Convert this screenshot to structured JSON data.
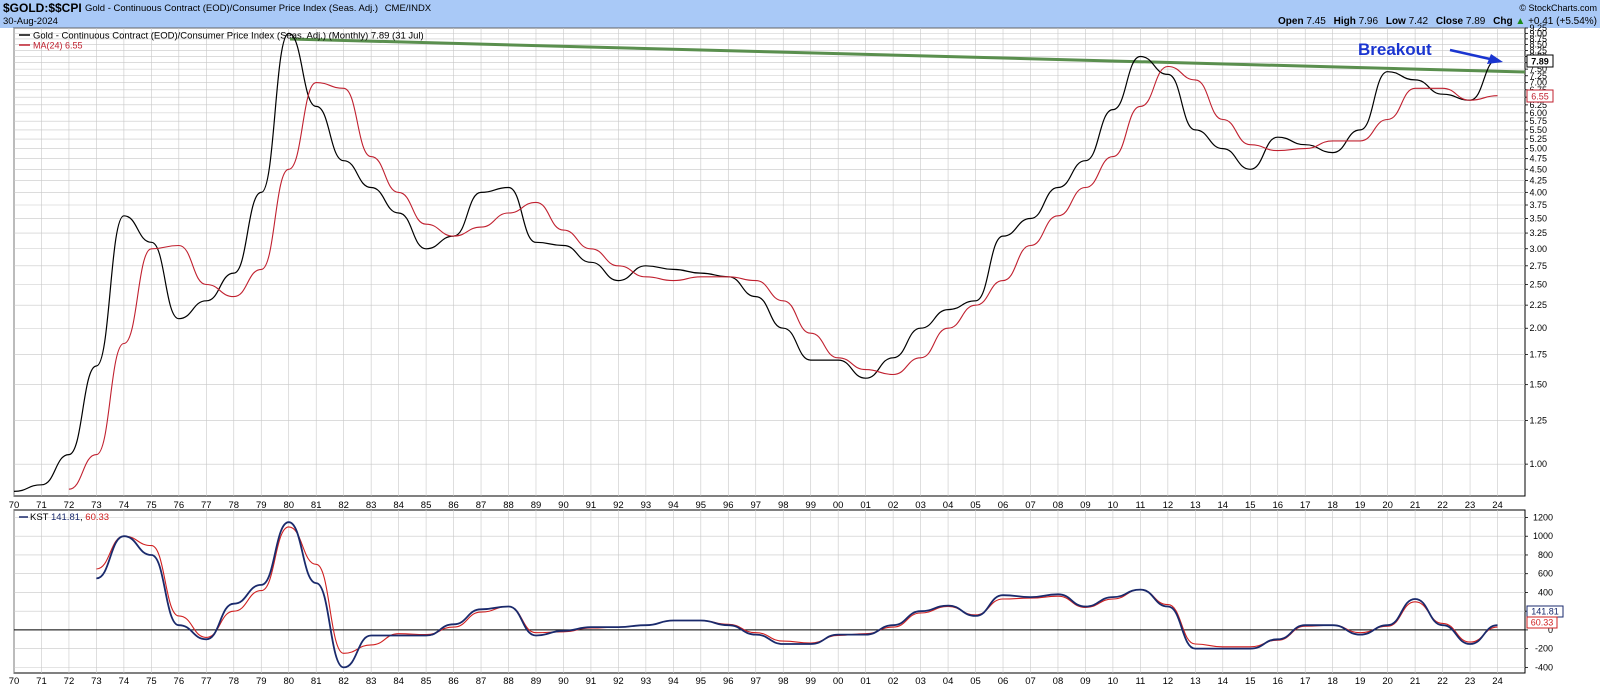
{
  "header": {
    "symbol": "$GOLD:$$CPI",
    "description": "Gold - Continuous Contract (EOD)/Consumer Price Index (Seas. Adj.)",
    "exchange": "CME/INDX",
    "date": "30-Aug-2024",
    "watermark": "© StockCharts.com",
    "quote": [
      {
        "label": "Open",
        "value": "7.45"
      },
      {
        "label": "High",
        "value": "7.96"
      },
      {
        "label": "Low",
        "value": "7.42"
      },
      {
        "label": "Close",
        "value": "7.89"
      },
      {
        "label": "Chg",
        "value": "+0.41 (+5.54%)"
      }
    ],
    "chg_arrow": "▲"
  },
  "main_legend": {
    "series_label": "Gold - Continuous Contract (EOD)/Consumer Price Index (Seas. Adj.) (Monthly) 7.89 (31 Jul)",
    "ma_label": "MA(24) 6.55"
  },
  "kst_legend": {
    "name": "KST",
    "value1": "141.81",
    "value2": "60.33"
  },
  "annotation": {
    "text": "Breakout"
  },
  "x_tick_labels": [
    "70",
    "71",
    "72",
    "73",
    "74",
    "75",
    "76",
    "77",
    "78",
    "79",
    "80",
    "81",
    "82",
    "83",
    "84",
    "85",
    "86",
    "87",
    "88",
    "89",
    "90",
    "91",
    "92",
    "93",
    "94",
    "95",
    "96",
    "97",
    "98",
    "99",
    "00",
    "01",
    "02",
    "03",
    "04",
    "05",
    "06",
    "07",
    "08",
    "09",
    "10",
    "11",
    "12",
    "13",
    "14",
    "15",
    "16",
    "17",
    "18",
    "19",
    "20",
    "21",
    "22",
    "23",
    "24"
  ],
  "colors": {
    "background": "#ffffff",
    "header_bg": "#a9c9f7",
    "price_line": "#000000",
    "ma_line": "#c0202f",
    "trendline": "#5a8f4e",
    "kst_line": "#1a2a6c",
    "kst_signal": "#d02020",
    "annotation": "#1a35d0",
    "grid": "#c8c8c8"
  },
  "chart_data": [
    {
      "type": "line",
      "scale": "log",
      "x": [
        1970,
        1971,
        1972,
        1973,
        1974,
        1975,
        1976,
        1977,
        1978,
        1979,
        1980,
        1981,
        1982,
        1983,
        1984,
        1985,
        1986,
        1987,
        1988,
        1989,
        1990,
        1991,
        1992,
        1993,
        1994,
        1995,
        1996,
        1997,
        1998,
        1999,
        2000,
        2001,
        2002,
        2003,
        2004,
        2005,
        2006,
        2007,
        2008,
        2009,
        2010,
        2011,
        2012,
        2013,
        2014,
        2015,
        2016,
        2017,
        2018,
        2019,
        2020,
        2021,
        2022,
        2023,
        2024
      ],
      "y_ticks": [
        1.0,
        1.25,
        1.5,
        1.75,
        2.0,
        2.25,
        2.5,
        2.75,
        3.0,
        3.25,
        3.5,
        3.75,
        4.0,
        4.25,
        4.5,
        4.75,
        5.0,
        5.25,
        5.5,
        5.75,
        6.0,
        6.25,
        6.5,
        6.75,
        7.0,
        7.25,
        7.5,
        7.75,
        8.0,
        8.25,
        8.5,
        8.75,
        9.0,
        9.25
      ],
      "ylim": [
        0.85,
        9.25
      ],
      "grid": true,
      "series": [
        {
          "name": "Gold - Continuous Contract (EOD)/Consumer Price Index (Seas. Adj.)",
          "values": [
            0.87,
            0.9,
            1.05,
            1.65,
            3.55,
            3.1,
            2.1,
            2.3,
            2.65,
            4.0,
            9.0,
            6.2,
            4.7,
            4.1,
            3.6,
            3.0,
            3.2,
            4.0,
            4.1,
            3.1,
            3.05,
            2.8,
            2.55,
            2.75,
            2.7,
            2.65,
            2.6,
            2.35,
            2.0,
            1.7,
            1.7,
            1.55,
            1.72,
            2.0,
            2.2,
            2.3,
            3.2,
            3.5,
            4.1,
            4.7,
            6.1,
            8.0,
            7.3,
            5.5,
            5.0,
            4.5,
            5.3,
            5.1,
            4.9,
            5.5,
            7.4,
            7.1,
            6.6,
            6.4,
            7.89
          ]
        },
        {
          "name": "MA(24)",
          "values": [
            null,
            null,
            0.88,
            1.05,
            1.85,
            3.0,
            3.05,
            2.5,
            2.35,
            2.7,
            4.5,
            7.0,
            6.8,
            4.8,
            4.0,
            3.4,
            3.2,
            3.35,
            3.6,
            3.8,
            3.3,
            3.0,
            2.75,
            2.6,
            2.55,
            2.6,
            2.6,
            2.55,
            2.3,
            1.95,
            1.72,
            1.62,
            1.58,
            1.72,
            2.0,
            2.25,
            2.55,
            3.05,
            3.55,
            4.1,
            4.8,
            6.2,
            7.6,
            7.1,
            5.8,
            5.1,
            4.95,
            5.0,
            5.2,
            5.2,
            5.8,
            6.8,
            6.8,
            6.4,
            6.55
          ]
        }
      ]
    },
    {
      "type": "line",
      "x": [
        1973,
        1974,
        1975,
        1976,
        1977,
        1978,
        1979,
        1980,
        1981,
        1982,
        1983,
        1984,
        1985,
        1986,
        1987,
        1988,
        1989,
        1990,
        1991,
        1992,
        1993,
        1994,
        1995,
        1996,
        1997,
        1998,
        1999,
        2000,
        2001,
        2002,
        2003,
        2004,
        2005,
        2006,
        2007,
        2008,
        2009,
        2010,
        2011,
        2012,
        2013,
        2014,
        2015,
        2016,
        2017,
        2018,
        2019,
        2020,
        2021,
        2022,
        2023,
        2024
      ],
      "y_ticks": [
        -400,
        -200,
        0,
        200,
        400,
        600,
        800,
        1000,
        1200
      ],
      "ylim": [
        -460,
        1280
      ],
      "zero_line": true,
      "series": [
        {
          "name": "KST",
          "values": [
            550,
            1000,
            800,
            50,
            -100,
            280,
            480,
            1150,
            500,
            -400,
            -60,
            -60,
            -60,
            60,
            220,
            250,
            -60,
            -10,
            30,
            30,
            50,
            100,
            100,
            50,
            -50,
            -150,
            -150,
            -50,
            -50,
            50,
            200,
            260,
            150,
            370,
            350,
            380,
            250,
            350,
            430,
            250,
            -200,
            -200,
            -200,
            -100,
            50,
            50,
            -50,
            50,
            330,
            50,
            -150,
            50,
            141.81
          ]
        },
        {
          "name": "",
          "values": [
            650,
            1000,
            900,
            150,
            -80,
            200,
            420,
            1100,
            700,
            -250,
            -160,
            -40,
            -50,
            30,
            190,
            250,
            -30,
            -20,
            20,
            30,
            50,
            100,
            100,
            60,
            -30,
            -120,
            -140,
            -60,
            -40,
            30,
            180,
            250,
            160,
            330,
            340,
            360,
            240,
            330,
            430,
            270,
            -150,
            -180,
            -180,
            -110,
            40,
            50,
            -30,
            40,
            300,
            70,
            -130,
            30,
            60.33
          ]
        }
      ]
    }
  ]
}
